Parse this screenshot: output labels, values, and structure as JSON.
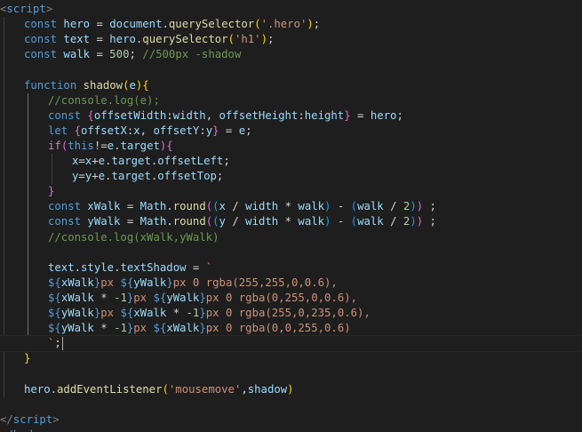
{
  "editor": {
    "language": "html",
    "lines": [
      [
        [
          "tagb",
          "<"
        ],
        [
          "tag",
          "script"
        ],
        [
          "tagb",
          ">"
        ]
      ],
      [
        [
          "kw",
          "const "
        ],
        [
          "var",
          "hero"
        ],
        [
          "punc",
          " = "
        ],
        [
          "var",
          "document"
        ],
        [
          "punc",
          "."
        ],
        [
          "fn",
          "querySelector"
        ],
        [
          "b1",
          "("
        ],
        [
          "str",
          "'.hero'"
        ],
        [
          "b1",
          ")"
        ],
        [
          "punc",
          ";"
        ]
      ],
      [
        [
          "kw",
          "const "
        ],
        [
          "var",
          "text"
        ],
        [
          "punc",
          " = "
        ],
        [
          "var",
          "hero"
        ],
        [
          "punc",
          "."
        ],
        [
          "fn",
          "querySelector"
        ],
        [
          "b1",
          "("
        ],
        [
          "str",
          "'h1'"
        ],
        [
          "b1",
          ")"
        ],
        [
          "punc",
          ";"
        ]
      ],
      [
        [
          "kw",
          "const "
        ],
        [
          "var",
          "walk"
        ],
        [
          "punc",
          " = "
        ],
        [
          "num",
          "500"
        ],
        [
          "punc",
          "; "
        ],
        [
          "cmt",
          "//500px -shadow"
        ]
      ],
      [],
      [
        [
          "kw",
          "function "
        ],
        [
          "fn",
          "shadow"
        ],
        [
          "b1",
          "("
        ],
        [
          "var",
          "e"
        ],
        [
          "b1",
          ")"
        ],
        [
          "b1",
          "{"
        ]
      ],
      [
        [
          "cmt",
          "//console.log(e);"
        ]
      ],
      [
        [
          "kw",
          "const "
        ],
        [
          "b2",
          "{"
        ],
        [
          "var",
          "offsetWidth"
        ],
        [
          "punc",
          ":"
        ],
        [
          "var",
          "width"
        ],
        [
          "punc",
          ", "
        ],
        [
          "var",
          "offsetHeight"
        ],
        [
          "punc",
          ":"
        ],
        [
          "var",
          "height"
        ],
        [
          "b2",
          "}"
        ],
        [
          "punc",
          " = "
        ],
        [
          "var",
          "hero"
        ],
        [
          "punc",
          ";"
        ]
      ],
      [
        [
          "kw",
          "let "
        ],
        [
          "b2",
          "{"
        ],
        [
          "var",
          "offsetX"
        ],
        [
          "punc",
          ":"
        ],
        [
          "var",
          "x"
        ],
        [
          "punc",
          ", "
        ],
        [
          "var",
          "offsetY"
        ],
        [
          "punc",
          ":"
        ],
        [
          "var",
          "y"
        ],
        [
          "b2",
          "}"
        ],
        [
          "punc",
          " = "
        ],
        [
          "var",
          "e"
        ],
        [
          "punc",
          ";"
        ]
      ],
      [
        [
          "ctl",
          "if"
        ],
        [
          "b2",
          "("
        ],
        [
          "kw",
          "this"
        ],
        [
          "punc",
          "!="
        ],
        [
          "var",
          "e"
        ],
        [
          "punc",
          "."
        ],
        [
          "var",
          "target"
        ],
        [
          "b2",
          ")"
        ],
        [
          "b2",
          "{"
        ]
      ],
      [
        [
          "var",
          "x"
        ],
        [
          "punc",
          "="
        ],
        [
          "var",
          "x"
        ],
        [
          "punc",
          "+"
        ],
        [
          "var",
          "e"
        ],
        [
          "punc",
          "."
        ],
        [
          "var",
          "target"
        ],
        [
          "punc",
          "."
        ],
        [
          "var",
          "offsetLeft"
        ],
        [
          "punc",
          ";"
        ]
      ],
      [
        [
          "var",
          "y"
        ],
        [
          "punc",
          "="
        ],
        [
          "var",
          "y"
        ],
        [
          "punc",
          "+"
        ],
        [
          "var",
          "e"
        ],
        [
          "punc",
          "."
        ],
        [
          "var",
          "target"
        ],
        [
          "punc",
          "."
        ],
        [
          "var",
          "offsetTop"
        ],
        [
          "punc",
          ";"
        ]
      ],
      [
        [
          "b2",
          "}"
        ]
      ],
      [
        [
          "kw",
          "const "
        ],
        [
          "var",
          "xWalk"
        ],
        [
          "punc",
          " = "
        ],
        [
          "var",
          "Math"
        ],
        [
          "punc",
          "."
        ],
        [
          "fn",
          "round"
        ],
        [
          "b2",
          "("
        ],
        [
          "b3",
          "("
        ],
        [
          "var",
          "x"
        ],
        [
          "punc",
          " / "
        ],
        [
          "var",
          "width"
        ],
        [
          "punc",
          " * "
        ],
        [
          "var",
          "walk"
        ],
        [
          "b3",
          ")"
        ],
        [
          "punc",
          " - "
        ],
        [
          "b3",
          "("
        ],
        [
          "var",
          "walk"
        ],
        [
          "punc",
          " / "
        ],
        [
          "num",
          "2"
        ],
        [
          "b3",
          ")"
        ],
        [
          "b2",
          ")"
        ],
        [
          "punc",
          " ;"
        ]
      ],
      [
        [
          "kw",
          "const "
        ],
        [
          "var",
          "yWalk"
        ],
        [
          "punc",
          " = "
        ],
        [
          "var",
          "Math"
        ],
        [
          "punc",
          "."
        ],
        [
          "fn",
          "round"
        ],
        [
          "b2",
          "("
        ],
        [
          "b3",
          "("
        ],
        [
          "var",
          "y"
        ],
        [
          "punc",
          " / "
        ],
        [
          "var",
          "width"
        ],
        [
          "punc",
          " * "
        ],
        [
          "var",
          "walk"
        ],
        [
          "b3",
          ")"
        ],
        [
          "punc",
          " - "
        ],
        [
          "b3",
          "("
        ],
        [
          "var",
          "walk"
        ],
        [
          "punc",
          " / "
        ],
        [
          "num",
          "2"
        ],
        [
          "b3",
          ")"
        ],
        [
          "b2",
          ")"
        ],
        [
          "punc",
          " ;"
        ]
      ],
      [
        [
          "cmt",
          "//console.log(xWalk,yWalk)"
        ]
      ],
      [],
      [
        [
          "var",
          "text"
        ],
        [
          "punc",
          "."
        ],
        [
          "var",
          "style"
        ],
        [
          "punc",
          "."
        ],
        [
          "var",
          "textShadow"
        ],
        [
          "punc",
          " = "
        ],
        [
          "str",
          "`"
        ]
      ],
      [
        [
          "kw",
          "${"
        ],
        [
          "var",
          "xWalk"
        ],
        [
          "kw",
          "}"
        ],
        [
          "str",
          "px "
        ],
        [
          "kw",
          "${"
        ],
        [
          "var",
          "yWalk"
        ],
        [
          "kw",
          "}"
        ],
        [
          "str",
          "px 0 rgba(255,255,0,0.6),"
        ]
      ],
      [
        [
          "kw",
          "${"
        ],
        [
          "var",
          "xWalk"
        ],
        [
          "punc",
          " * "
        ],
        [
          "num",
          "-1"
        ],
        [
          "kw",
          "}"
        ],
        [
          "str",
          "px "
        ],
        [
          "kw",
          "${"
        ],
        [
          "var",
          "yWalk"
        ],
        [
          "kw",
          "}"
        ],
        [
          "str",
          "px 0 rgba(0,255,0,0.6),"
        ]
      ],
      [
        [
          "kw",
          "${"
        ],
        [
          "var",
          "yWalk"
        ],
        [
          "kw",
          "}"
        ],
        [
          "str",
          "px "
        ],
        [
          "kw",
          "${"
        ],
        [
          "var",
          "xWalk"
        ],
        [
          "punc",
          " * "
        ],
        [
          "num",
          "-1"
        ],
        [
          "kw",
          "}"
        ],
        [
          "str",
          "px 0 rgba(255,0,235,0.6),"
        ]
      ],
      [
        [
          "kw",
          "${"
        ],
        [
          "var",
          "yWalk"
        ],
        [
          "punc",
          " * "
        ],
        [
          "num",
          "-1"
        ],
        [
          "kw",
          "}"
        ],
        [
          "str",
          "px "
        ],
        [
          "kw",
          "${"
        ],
        [
          "var",
          "xWalk"
        ],
        [
          "kw",
          "}"
        ],
        [
          "str",
          "px 0 rgba(0,0,255,0.6)"
        ]
      ],
      [
        [
          "str",
          "`"
        ],
        [
          "punc",
          ";"
        ]
      ],
      [
        [
          "b1",
          "}"
        ]
      ],
      [],
      [
        [
          "var",
          "hero"
        ],
        [
          "punc",
          "."
        ],
        [
          "fn",
          "addEventListener"
        ],
        [
          "b1",
          "("
        ],
        [
          "str",
          "'mousemove'"
        ],
        [
          "punc",
          ","
        ],
        [
          "var",
          "shadow"
        ],
        [
          "b1",
          ")"
        ]
      ],
      [],
      [
        [
          "tagb",
          "</"
        ],
        [
          "tag",
          "script"
        ],
        [
          "tagb",
          ">"
        ]
      ],
      [
        [
          "tagb",
          "</"
        ],
        [
          "tag",
          "body"
        ],
        [
          "tagb",
          ">"
        ]
      ]
    ]
  }
}
